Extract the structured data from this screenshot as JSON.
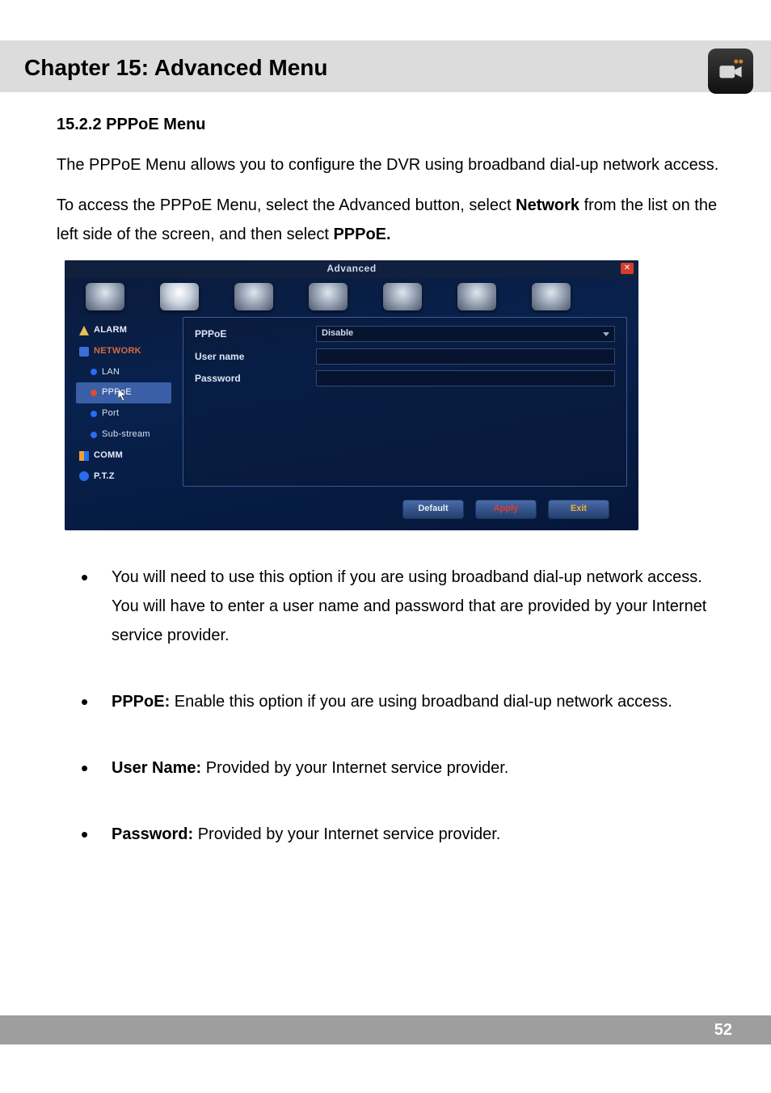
{
  "chapter_title": "Chapter 15: Advanced Menu",
  "section_title": "15.2.2 PPPoE Menu",
  "intro_para": "The PPPoE Menu allows you to configure the DVR using broadband dial-up network access.",
  "access_para_pre": "To access the PPPoE Menu, select the Advanced button, select ",
  "access_para_bold1": "Network",
  "access_para_mid": " from the list on the left side of the screen, and then select ",
  "access_para_bold2": "PPPoE.",
  "screenshot": {
    "window_title": "Advanced",
    "sidebar": {
      "alarm": "ALARM",
      "network": "NETWORK",
      "lan": "LAN",
      "pppoe": "PPPoE",
      "port": "Port",
      "substream": "Sub-stream",
      "comm": "COMM",
      "ptz": "P.T.Z"
    },
    "form": {
      "pppoe_label": "PPPoE",
      "pppoe_value": "Disable",
      "username_label": "User name",
      "username_value": "",
      "password_label": "Password",
      "password_value": ""
    },
    "buttons": {
      "default": "Default",
      "apply": "Apply",
      "exit": "Exit"
    }
  },
  "bullets": {
    "b1": "You will need to use this option if you are using broadband dial-up network access. You will have to enter a user name and password that are provided by your Internet service provider.",
    "b2_bold": "PPPoE:",
    "b2": " Enable this option if you are using broadband dial-up network access.",
    "b3_bold": "User Name:",
    "b3": " Provided by your Internet service provider.",
    "b4_bold": "Password:",
    "b4": " Provided by your Internet service provider."
  },
  "page_number": "52"
}
